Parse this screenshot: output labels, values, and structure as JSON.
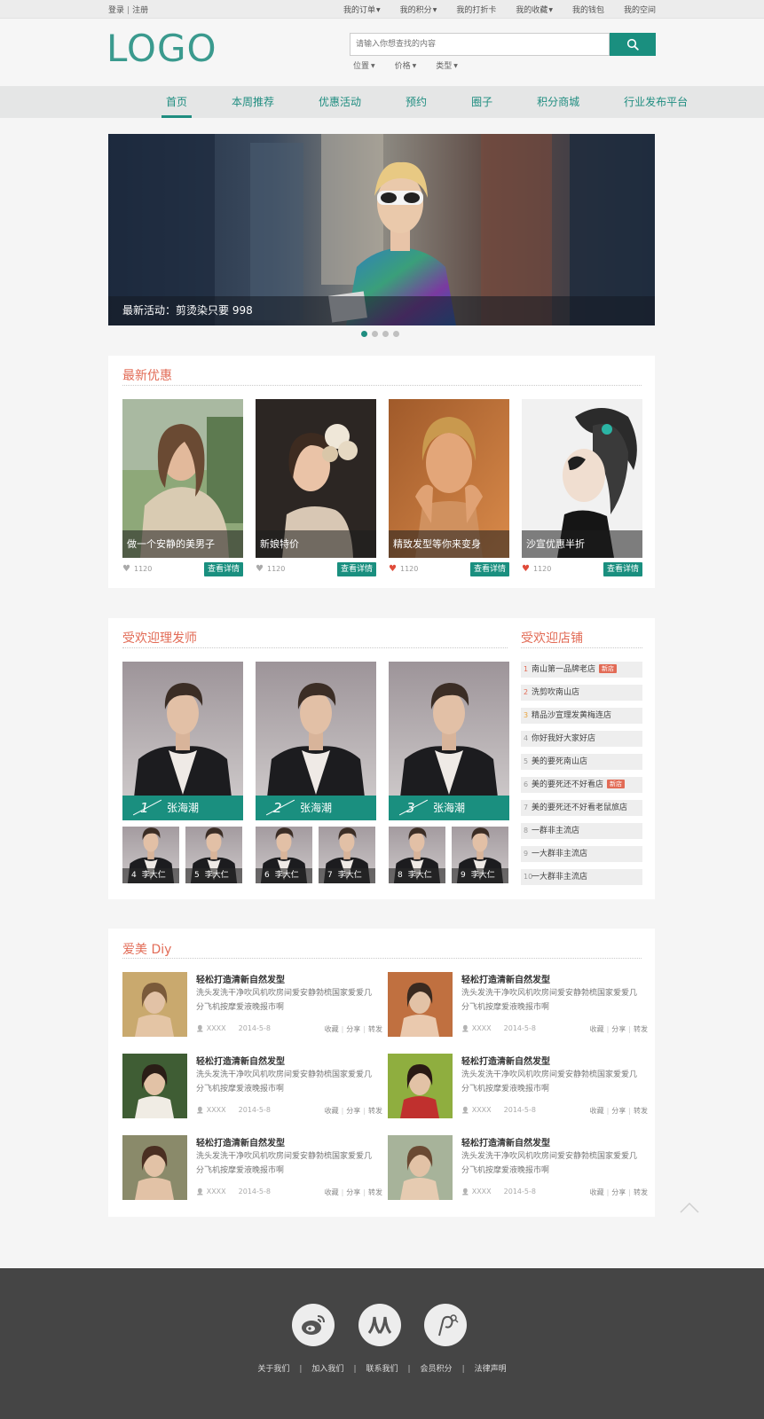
{
  "topbar": {
    "login": "登录",
    "register": "注册",
    "links": [
      {
        "label": "我的订单",
        "dropdown": true
      },
      {
        "label": "我的积分",
        "dropdown": true
      },
      {
        "label": "我的打折卡",
        "dropdown": false
      },
      {
        "label": "我的收藏",
        "dropdown": true
      },
      {
        "label": "我的钱包",
        "dropdown": false
      },
      {
        "label": "我的空间",
        "dropdown": false
      }
    ]
  },
  "header": {
    "logo": "LOGO",
    "search_placeholder": "请输入你想查找的内容",
    "search_icon": "search-icon",
    "filters": [
      "位置",
      "价格",
      "类型"
    ]
  },
  "nav": {
    "items": [
      "首页",
      "本周推荐",
      "优惠活动",
      "预约",
      "圈子",
      "积分商城",
      "行业发布平台"
    ],
    "active": "首页"
  },
  "banner": {
    "caption": "最新活动：剪烫染只要 998",
    "dots": 4,
    "active_dot": 0
  },
  "latest": {
    "title": "最新优惠",
    "detail_label": "查看详情",
    "cards": [
      {
        "caption": "做一个安静的美男子",
        "likes": "1120",
        "liked": false
      },
      {
        "caption": "新娘特价",
        "likes": "1120",
        "liked": false
      },
      {
        "caption": "精致发型等你来变身",
        "likes": "1120",
        "liked": true
      },
      {
        "caption": "沙宣优惠半折",
        "likes": "1120",
        "liked": true
      }
    ]
  },
  "stylists": {
    "title": "受欢迎理发师",
    "top": [
      {
        "rank": "1",
        "name": "张海潮"
      },
      {
        "rank": "2",
        "name": "张海潮"
      },
      {
        "rank": "3",
        "name": "张海潮"
      }
    ],
    "others": [
      {
        "rank": "4",
        "name": "李大仁"
      },
      {
        "rank": "5",
        "name": "李大仁"
      },
      {
        "rank": "6",
        "name": "李大仁"
      },
      {
        "rank": "7",
        "name": "李大仁"
      },
      {
        "rank": "8",
        "name": "李大仁"
      },
      {
        "rank": "9",
        "name": "李大仁"
      }
    ]
  },
  "shops": {
    "title": "受欢迎店铺",
    "items": [
      {
        "rank": "1",
        "name": "南山第一品牌老店",
        "badge": "新店"
      },
      {
        "rank": "2",
        "name": "洗剪吹南山店",
        "badge": ""
      },
      {
        "rank": "3",
        "name": "精品沙宣理发黄梅连店",
        "badge": ""
      },
      {
        "rank": "4",
        "name": "你好我好大家好店",
        "badge": ""
      },
      {
        "rank": "5",
        "name": "美的要死南山店",
        "badge": ""
      },
      {
        "rank": "6",
        "name": "美的要死还不好看店",
        "badge": "新店"
      },
      {
        "rank": "7",
        "name": "美的要死还不好看老鼠旅店",
        "badge": ""
      },
      {
        "rank": "8",
        "name": "一群非主流店",
        "badge": ""
      },
      {
        "rank": "9",
        "name": "一大群非主流店",
        "badge": ""
      },
      {
        "rank": "10",
        "name": "一大群非主流店",
        "badge": ""
      }
    ]
  },
  "diy": {
    "title": "爱美 Diy",
    "articles": [
      {
        "title": "轻松打造清新自然发型",
        "desc": "洗头发洗干净吹风机吹房间爱安静勃梳国家爱爱几分飞机按摩爱液晚报市啊",
        "user": "XXXX",
        "date": "2014-5-8",
        "actions": [
          "收藏",
          "分享",
          "转发"
        ]
      },
      {
        "title": "轻松打造清新自然发型",
        "desc": "洗头发洗干净吹风机吹房间爱安静勃梳国家爱爱几分飞机按摩爱液晚报市啊",
        "user": "XXXX",
        "date": "2014-5-8",
        "actions": [
          "收藏",
          "分享",
          "转发"
        ]
      },
      {
        "title": "轻松打造清新自然发型",
        "desc": "洗头发洗干净吹风机吹房间爱安静勃梳国家爱爱几分飞机按摩爱液晚报市啊",
        "user": "XXXX",
        "date": "2014-5-8",
        "actions": [
          "收藏",
          "分享",
          "转发"
        ]
      },
      {
        "title": "轻松打造清新自然发型",
        "desc": "洗头发洗干净吹风机吹房间爱安静勃梳国家爱爱几分飞机按摩爱液晚报市啊",
        "user": "XXXX",
        "date": "2014-5-8",
        "actions": [
          "收藏",
          "分享",
          "转发"
        ]
      },
      {
        "title": "轻松打造清新自然发型",
        "desc": "洗头发洗干净吹风机吹房间爱安静勃梳国家爱爱几分飞机按摩爱液晚报市啊",
        "user": "XXXX",
        "date": "2014-5-8",
        "actions": [
          "收藏",
          "分享",
          "转发"
        ]
      },
      {
        "title": "轻松打造清新自然发型",
        "desc": "洗头发洗干净吹风机吹房间爱安静勃梳国家爱爱几分飞机按摩爱液晚报市啊",
        "user": "XXXX",
        "date": "2014-5-8",
        "actions": [
          "收藏",
          "分享",
          "转发"
        ]
      }
    ]
  },
  "footer": {
    "social": [
      "weibo-icon",
      "renren-icon",
      "pinterest-icon"
    ],
    "links": [
      "关于我们",
      "加入我们",
      "联系我们",
      "会员积分",
      "法律声明"
    ]
  },
  "colors": {
    "accent": "#1a8f7f",
    "title_red": "#e26b56",
    "footer_bg": "#454545"
  }
}
